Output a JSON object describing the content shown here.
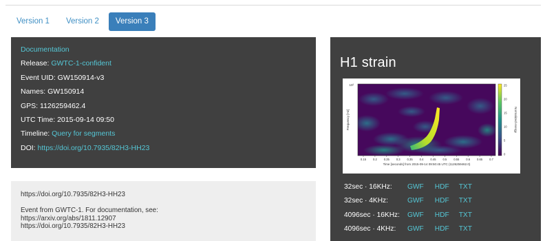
{
  "tabs": [
    {
      "label": "Version 1",
      "active": false
    },
    {
      "label": "Version 2",
      "active": false
    },
    {
      "label": "Version 3",
      "active": true
    }
  ],
  "event": {
    "documentation_link": "Documentation",
    "release_label": "Release: ",
    "release_value": "GWTC-1-confident",
    "uid": "Event UID: GW150914-v3",
    "names": "Names: GW150914",
    "gps": "GPS: 1126259462.4",
    "utc": "UTC Time: 2015-09-14 09:50",
    "timeline_label": "Timeline: ",
    "timeline_link": "Query for segments",
    "doi_label": "DOI: ",
    "doi_link": "https://doi.org/10.7935/82H3-HH23"
  },
  "description": {
    "line1": "https://doi.org/10.7935/82H3-HH23",
    "line2": "Event from GWTC-1.  For documentation, see:",
    "line3": "https://arxiv.org/abs/1811.12907",
    "line4": "https://doi.org/10.7935/82H3-HH23"
  },
  "strain": {
    "title": "H1 strain",
    "plot": {
      "ylabel": "Frequency [Hz]",
      "xlabel": "Time [seconds] from 2015-09-14 09:50:45 UTC (1126259462.0)",
      "colorbar_label": "Normalized energy",
      "colorbar_ticks": [
        "25",
        "20",
        "15",
        "10",
        "5",
        "0"
      ],
      "ytick_top": "10²",
      "xticks": [
        "0.15",
        "0.2",
        "0.25",
        "0.3",
        "0.35",
        "0.4",
        "0.45",
        "0.5",
        "0.55",
        "0.6",
        "0.65",
        "0.7"
      ],
      "colormap": [
        "#440154",
        "#3b528b",
        "#21918c",
        "#5ec962",
        "#fde725"
      ]
    },
    "downloads": [
      {
        "label": "32sec · 16KHz:",
        "links": [
          "GWF",
          "HDF",
          "TXT"
        ]
      },
      {
        "label": "32sec · 4KHz:",
        "links": [
          "GWF",
          "HDF",
          "TXT"
        ]
      },
      {
        "label": "4096sec · 16KHz:",
        "links": [
          "GWF",
          "HDF",
          "TXT"
        ]
      },
      {
        "label": "4096sec · 4KHz:",
        "links": [
          "GWF",
          "HDF",
          "TXT"
        ]
      }
    ]
  },
  "colors": {
    "panel_bg": "#404040",
    "link": "#55c7d6",
    "tab_text": "#3f8fc4",
    "tab_active_bg": "#3a7fba",
    "desc_bg": "#eeeeee"
  }
}
